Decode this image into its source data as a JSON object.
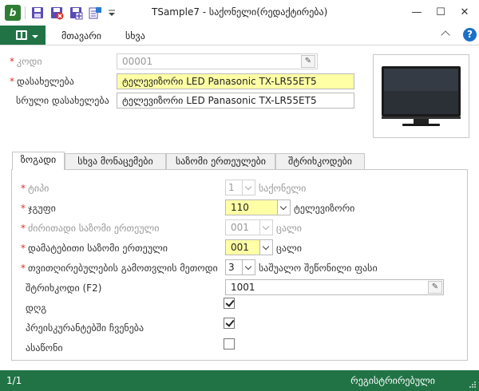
{
  "window": {
    "app_icon_glyph": "b",
    "title": "TSample7 - საქონელი(რედაქტირება)",
    "minimize": "—",
    "maximize": "☐",
    "close": "✕"
  },
  "quick_access": [
    "save-icon",
    "save-close-icon",
    "save-new-icon",
    "export-icon",
    "dropdown-icon"
  ],
  "ribbon": {
    "tabs": [
      "მთავარი",
      "სხვა"
    ],
    "help": "?"
  },
  "header_form": {
    "code_label": "კოდი",
    "code_value": "00001",
    "name_label": "დასახელება",
    "name_value": "ტელევიზორი LED Panasonic TX-LR55ET5",
    "fullname_label": "სრული დასახელება",
    "fullname_value": "ტელევიზორი LED Panasonic TX-LR55ET5"
  },
  "tabs": [
    "ზოგადი",
    "სხვა მონაცემები",
    "საზომი ერთეულები",
    "შტრიხკოდები"
  ],
  "general": {
    "type_label": "ტიპი",
    "type_value": "1",
    "type_text": "საქონელი",
    "group_label": "ჯგუფი",
    "group_value": "110",
    "group_text": "ტელევიზორი",
    "base_unit_label": "ძირითადი საზომი ერთეული",
    "base_unit_value": "001",
    "base_unit_text": "ცალი",
    "extra_unit_label": "დამატებითი საზომი ერთეული",
    "extra_unit_value": "001",
    "extra_unit_text": "ცალი",
    "cost_method_label": "თვითღირებულების გამოთვლის მეთოდი",
    "cost_method_value": "3",
    "cost_method_text": "საშუალო შეწონილი ფასი",
    "barcode_label": "შტრიხკოდი (F2)",
    "barcode_value": "1001",
    "vat_label": "დღგ",
    "vat_checked": true,
    "pricelist_label": "პრეისკურანტებში ჩვენება",
    "pricelist_checked": true,
    "archive_label": "ასაწონი",
    "archive_checked": false
  },
  "status": {
    "record": "1/1",
    "state": "რეგისტრირებული"
  },
  "colors": {
    "accent": "#217346",
    "required": "#d9342b",
    "highlight": "#ffffa6"
  }
}
